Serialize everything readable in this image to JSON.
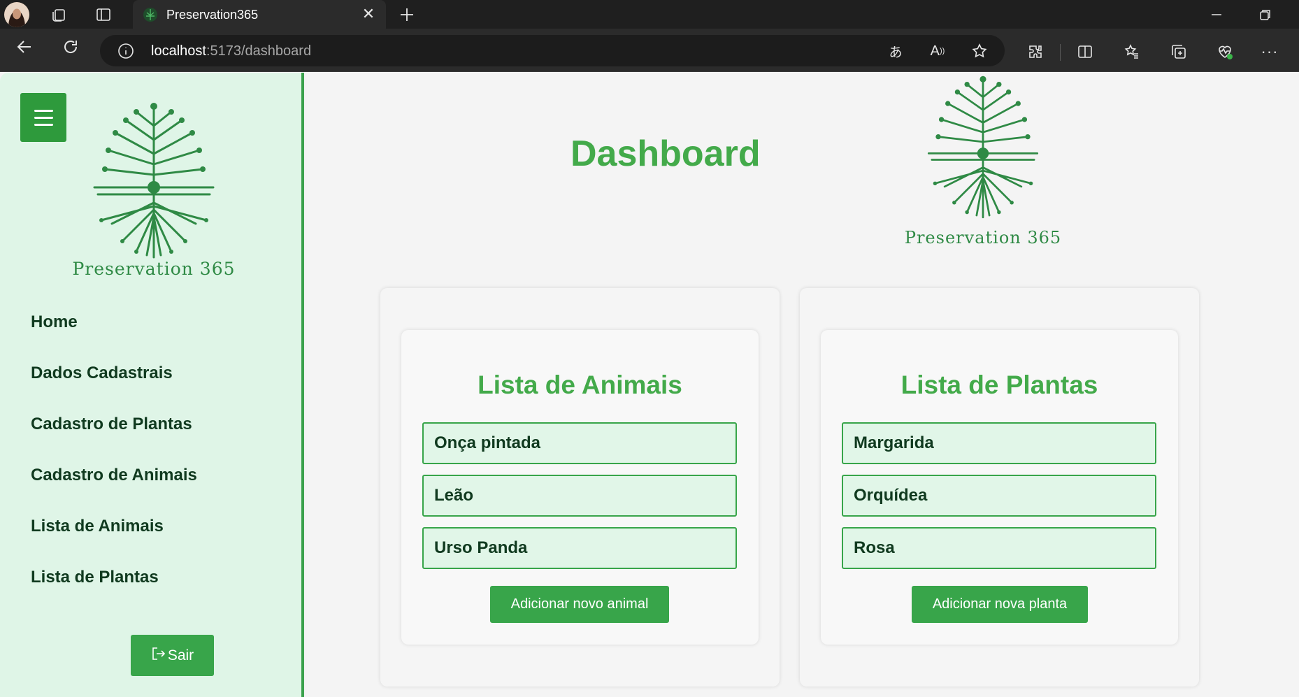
{
  "browser": {
    "tab_title": "Preservation365",
    "url_host": "localhost",
    "url_rest": ":5173/dashboard"
  },
  "sidebar": {
    "logo_caption": "Preservation 365",
    "nav": [
      {
        "label": "Home"
      },
      {
        "label": "Dados Cadastrais"
      },
      {
        "label": "Cadastro de Plantas"
      },
      {
        "label": "Cadastro de Animais"
      },
      {
        "label": "Lista de Animais"
      },
      {
        "label": "Lista de Plantas"
      }
    ],
    "logout_label": "Sair"
  },
  "main": {
    "title": "Dashboard",
    "logo_caption": "Preservation 365",
    "animals": {
      "title": "Lista de Animais",
      "items": [
        "Onça pintada",
        "Leão",
        "Urso Panda"
      ],
      "button": "Adicionar novo animal"
    },
    "plants": {
      "title": "Lista de Plantas",
      "items": [
        "Margarida",
        "Orquídea",
        "Rosa"
      ],
      "button": "Adicionar nova planta"
    }
  },
  "colors": {
    "accent_green": "#38a54a",
    "title_green": "#43aa4a",
    "sidebar_bg": "#dff5e7",
    "text_dark": "#103a1f"
  }
}
